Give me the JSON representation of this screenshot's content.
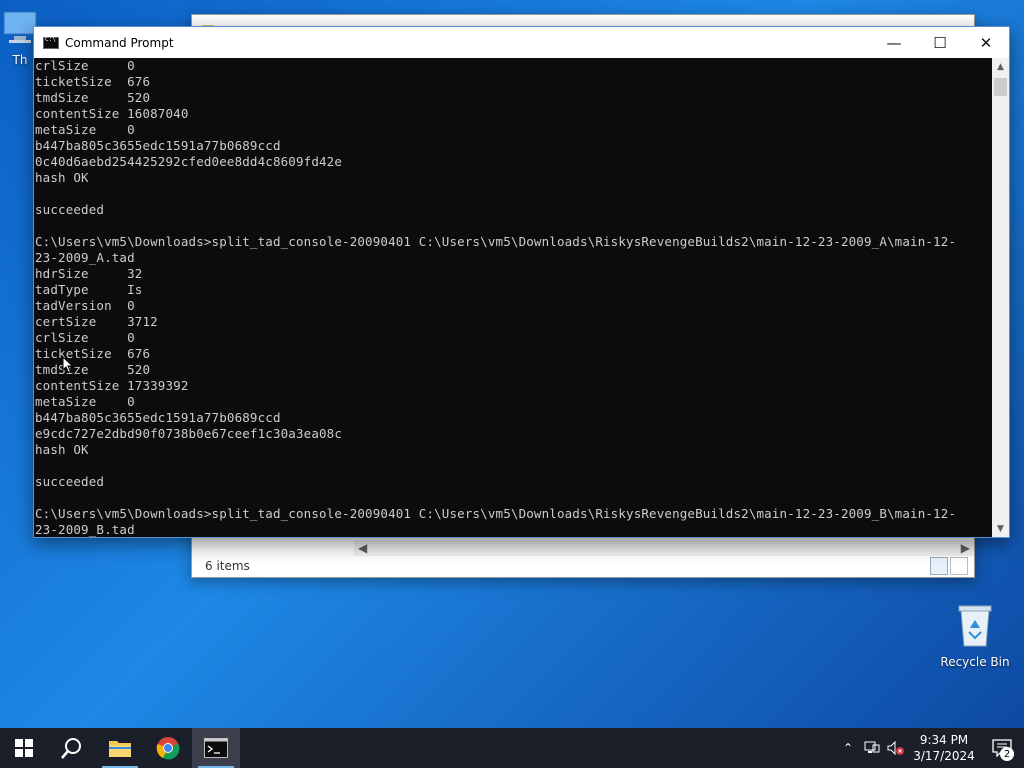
{
  "desktop": {
    "icons": {
      "this_pc_label": "Th",
      "recycle_bin_label": "Recycle Bin"
    }
  },
  "explorer": {
    "status_text": "6 items"
  },
  "cmd": {
    "title": "Command Prompt",
    "lines": [
      "crlSize     0",
      "ticketSize  676",
      "tmdSize     520",
      "contentSize 16087040",
      "metaSize    0",
      "b447ba805c3655edc1591a77b0689ccd",
      "0c40d6aebd254425292cfed0ee8dd4c8609fd42e",
      "hash OK",
      "",
      "succeeded",
      "",
      "C:\\Users\\vm5\\Downloads>split_tad_console-20090401 C:\\Users\\vm5\\Downloads\\RiskysRevengeBuilds2\\main-12-23-2009_A\\main-12-",
      "23-2009_A.tad",
      "hdrSize     32",
      "tadType     Is",
      "tadVersion  0",
      "certSize    3712",
      "crlSize     0",
      "ticketSize  676",
      "tmdSize     520",
      "contentSize 17339392",
      "metaSize    0",
      "b447ba805c3655edc1591a77b0689ccd",
      "e9cdc727e2dbd90f0738b0e67ceef1c30a3ea08c",
      "hash OK",
      "",
      "succeeded",
      "",
      "C:\\Users\\vm5\\Downloads>split_tad_console-20090401 C:\\Users\\vm5\\Downloads\\RiskysRevengeBuilds2\\main-12-23-2009_B\\main-12-",
      "23-2009_B.tad"
    ]
  },
  "taskbar": {
    "clock_time": "9:34 PM",
    "clock_date": "3/17/2024",
    "notification_count": "2"
  },
  "icons": {
    "start": "windows-logo-icon",
    "search": "search-icon",
    "explorer": "folder-icon",
    "chrome": "chrome-icon",
    "cmd": "terminal-icon"
  },
  "colors": {
    "console_bg": "#0c0c0c",
    "console_text": "#cccccc",
    "taskbar_bg": "#1b1f2a",
    "accent": "#76b9ed"
  }
}
